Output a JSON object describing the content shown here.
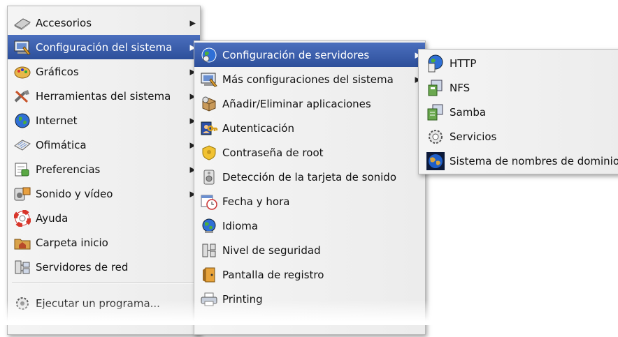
{
  "main_menu": {
    "items": [
      {
        "label": "Accesorios",
        "icon": "accessories-icon",
        "submenu": true
      },
      {
        "label": "Configuración del sistema",
        "icon": "system-settings-icon",
        "submenu": true,
        "selected": true
      },
      {
        "label": "Gráficos",
        "icon": "graphics-icon",
        "submenu": true
      },
      {
        "label": "Herramientas del sistema",
        "icon": "system-tools-icon",
        "submenu": true
      },
      {
        "label": "Internet",
        "icon": "internet-globe-icon",
        "submenu": true
      },
      {
        "label": "Ofimática",
        "icon": "office-icon",
        "submenu": true
      },
      {
        "label": "Preferencias",
        "icon": "preferences-icon",
        "submenu": true
      },
      {
        "label": "Sonido y vídeo",
        "icon": "sound-video-icon",
        "submenu": true
      },
      {
        "label": "Ayuda",
        "icon": "help-lifebuoy-icon",
        "submenu": false
      },
      {
        "label": "Carpeta inicio",
        "icon": "home-folder-icon",
        "submenu": false
      },
      {
        "label": "Servidores de red",
        "icon": "network-servers-icon",
        "submenu": false
      }
    ],
    "run_item": {
      "label": "Ejecutar un programa...",
      "icon": "run-program-icon"
    }
  },
  "config_menu": {
    "items": [
      {
        "label": "Configuración de servidores",
        "icon": "server-config-icon",
        "submenu": true,
        "selected": true
      },
      {
        "label": "Más configuraciones del sistema",
        "icon": "more-config-icon",
        "submenu": true
      },
      {
        "label": "Añadir/Eliminar aplicaciones",
        "icon": "add-remove-apps-icon",
        "submenu": false
      },
      {
        "label": "Autenticación",
        "icon": "authentication-icon",
        "submenu": false
      },
      {
        "label": "Contraseña de root",
        "icon": "root-password-icon",
        "submenu": false
      },
      {
        "label": "Detección de la tarjeta de sonido",
        "icon": "soundcard-detection-icon",
        "submenu": false
      },
      {
        "label": "Fecha y hora",
        "icon": "date-time-icon",
        "submenu": false
      },
      {
        "label": "Idioma",
        "icon": "language-icon",
        "submenu": false
      },
      {
        "label": "Nivel de seguridad",
        "icon": "security-level-icon",
        "submenu": false
      },
      {
        "label": "Pantalla de registro",
        "icon": "login-screen-icon",
        "submenu": false
      },
      {
        "label": "Printing",
        "icon": "printer-icon",
        "submenu": false
      }
    ]
  },
  "servers_menu": {
    "items": [
      {
        "label": "HTTP",
        "icon": "http-server-icon"
      },
      {
        "label": "NFS",
        "icon": "nfs-server-icon"
      },
      {
        "label": "Samba",
        "icon": "samba-server-icon"
      },
      {
        "label": "Servicios",
        "icon": "services-gear-icon"
      },
      {
        "label": "Sistema de nombres de dominio",
        "icon": "dns-globe-icon"
      }
    ]
  },
  "colors": {
    "selection": "#3a5ca8",
    "menu_bg": "#efefef",
    "text": "#111111"
  }
}
